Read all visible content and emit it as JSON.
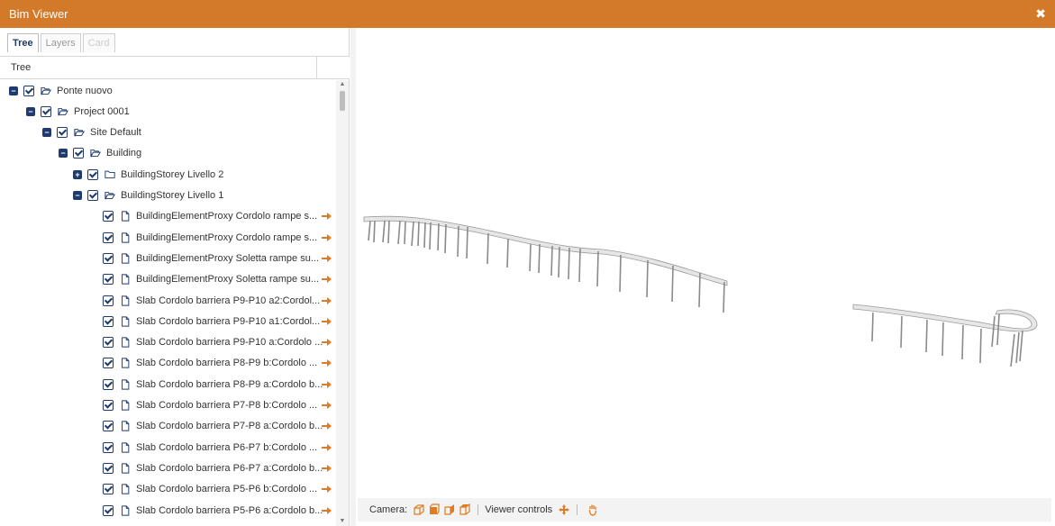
{
  "window": {
    "title": "Bim Viewer",
    "close_glyph": "✖"
  },
  "tabs": [
    {
      "label": "Tree",
      "state": "active"
    },
    {
      "label": "Layers",
      "state": "inactive"
    },
    {
      "label": "Card",
      "state": "disabled"
    }
  ],
  "grid": {
    "column_header": "Tree"
  },
  "tree": [
    {
      "label": "Ponte nuovo",
      "expander": "minus",
      "icon": "folder-open-icon"
    },
    {
      "label": "Project 0001",
      "expander": "minus",
      "icon": "folder-open-icon"
    },
    {
      "label": "Site Default",
      "expander": "minus",
      "icon": "folder-open-icon"
    },
    {
      "label": "Building",
      "expander": "minus",
      "icon": "folder-open-icon"
    },
    {
      "label": "BuildingStorey Livello 2",
      "expander": "plus",
      "icon": "folder-icon"
    },
    {
      "label": "BuildingStorey Livello 1",
      "expander": "minus",
      "icon": "folder-open-icon"
    },
    {
      "label": "BuildingElementProxy Cordolo rampe s...",
      "icon": "file-icon",
      "action": "arrow-right-icon"
    },
    {
      "label": "BuildingElementProxy Cordolo rampe s...",
      "icon": "file-icon",
      "action": "arrow-right-icon"
    },
    {
      "label": "BuildingElementProxy Soletta rampe su...",
      "icon": "file-icon",
      "action": "arrow-right-icon"
    },
    {
      "label": "BuildingElementProxy Soletta rampe su...",
      "icon": "file-icon",
      "action": "arrow-right-icon"
    },
    {
      "label": "Slab Cordolo barriera P9-P10 a2:Cordol...",
      "icon": "file-icon",
      "action": "arrow-right-icon"
    },
    {
      "label": "Slab Cordolo barriera P9-P10 a1:Cordol...",
      "icon": "file-icon",
      "action": "arrow-right-icon"
    },
    {
      "label": "Slab Cordolo barriera P9-P10 a:Cordolo ...",
      "icon": "file-icon",
      "action": "arrow-right-icon"
    },
    {
      "label": "Slab Cordolo barriera P8-P9 b:Cordolo ...",
      "icon": "file-icon",
      "action": "arrow-right-icon"
    },
    {
      "label": "Slab Cordolo barriera P8-P9 a:Cordolo b...",
      "icon": "file-icon",
      "action": "arrow-right-icon"
    },
    {
      "label": "Slab Cordolo barriera P7-P8 b:Cordolo ...",
      "icon": "file-icon",
      "action": "arrow-right-icon"
    },
    {
      "label": "Slab Cordolo barriera P7-P8 a:Cordolo b...",
      "icon": "file-icon",
      "action": "arrow-right-icon"
    },
    {
      "label": "Slab Cordolo barriera P6-P7 b:Cordolo ...",
      "icon": "file-icon",
      "action": "arrow-right-icon"
    },
    {
      "label": "Slab Cordolo barriera P6-P7 a:Cordolo b...",
      "icon": "file-icon",
      "action": "arrow-right-icon"
    },
    {
      "label": "Slab Cordolo barriera P5-P6 b:Cordolo ...",
      "icon": "file-icon",
      "action": "arrow-right-icon"
    },
    {
      "label": "Slab Cordolo barriera P5-P6 a:Cordolo b...",
      "icon": "file-icon",
      "action": "arrow-right-icon"
    }
  ],
  "viewer": {
    "camera_label": "Camera:",
    "camera_icons": [
      "camera-perspective-icon",
      "camera-front-icon",
      "camera-side-icon",
      "camera-top-icon"
    ],
    "controls_label": "Viewer controls",
    "control_icons": [
      "move-icon",
      "hand-icon"
    ]
  },
  "colors": {
    "brand": "#d27a2a",
    "primary": "#1e3a6e",
    "accent_arrow": "#e07b22"
  }
}
